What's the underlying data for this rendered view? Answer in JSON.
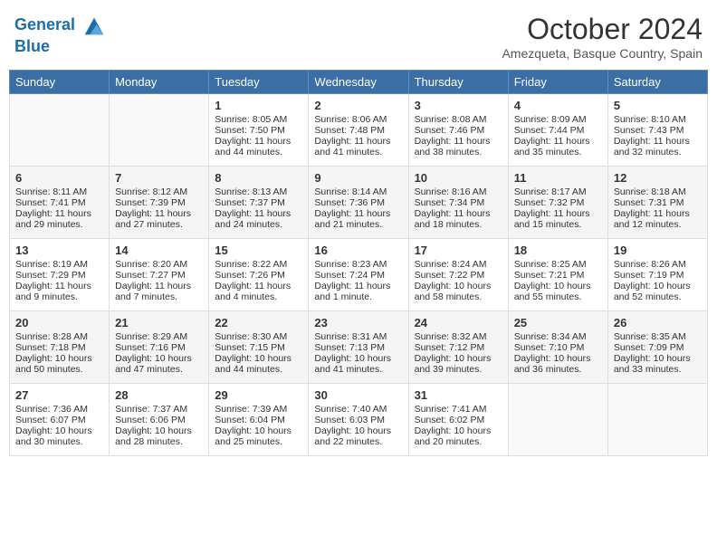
{
  "header": {
    "logo_line1": "General",
    "logo_line2": "Blue",
    "month_year": "October 2024",
    "location": "Amezqueta, Basque Country, Spain"
  },
  "days_of_week": [
    "Sunday",
    "Monday",
    "Tuesday",
    "Wednesday",
    "Thursday",
    "Friday",
    "Saturday"
  ],
  "weeks": [
    [
      {
        "day": "",
        "sunrise": "",
        "sunset": "",
        "daylight": ""
      },
      {
        "day": "",
        "sunrise": "",
        "sunset": "",
        "daylight": ""
      },
      {
        "day": "1",
        "sunrise": "Sunrise: 8:05 AM",
        "sunset": "Sunset: 7:50 PM",
        "daylight": "Daylight: 11 hours and 44 minutes."
      },
      {
        "day": "2",
        "sunrise": "Sunrise: 8:06 AM",
        "sunset": "Sunset: 7:48 PM",
        "daylight": "Daylight: 11 hours and 41 minutes."
      },
      {
        "day": "3",
        "sunrise": "Sunrise: 8:08 AM",
        "sunset": "Sunset: 7:46 PM",
        "daylight": "Daylight: 11 hours and 38 minutes."
      },
      {
        "day": "4",
        "sunrise": "Sunrise: 8:09 AM",
        "sunset": "Sunset: 7:44 PM",
        "daylight": "Daylight: 11 hours and 35 minutes."
      },
      {
        "day": "5",
        "sunrise": "Sunrise: 8:10 AM",
        "sunset": "Sunset: 7:43 PM",
        "daylight": "Daylight: 11 hours and 32 minutes."
      }
    ],
    [
      {
        "day": "6",
        "sunrise": "Sunrise: 8:11 AM",
        "sunset": "Sunset: 7:41 PM",
        "daylight": "Daylight: 11 hours and 29 minutes."
      },
      {
        "day": "7",
        "sunrise": "Sunrise: 8:12 AM",
        "sunset": "Sunset: 7:39 PM",
        "daylight": "Daylight: 11 hours and 27 minutes."
      },
      {
        "day": "8",
        "sunrise": "Sunrise: 8:13 AM",
        "sunset": "Sunset: 7:37 PM",
        "daylight": "Daylight: 11 hours and 24 minutes."
      },
      {
        "day": "9",
        "sunrise": "Sunrise: 8:14 AM",
        "sunset": "Sunset: 7:36 PM",
        "daylight": "Daylight: 11 hours and 21 minutes."
      },
      {
        "day": "10",
        "sunrise": "Sunrise: 8:16 AM",
        "sunset": "Sunset: 7:34 PM",
        "daylight": "Daylight: 11 hours and 18 minutes."
      },
      {
        "day": "11",
        "sunrise": "Sunrise: 8:17 AM",
        "sunset": "Sunset: 7:32 PM",
        "daylight": "Daylight: 11 hours and 15 minutes."
      },
      {
        "day": "12",
        "sunrise": "Sunrise: 8:18 AM",
        "sunset": "Sunset: 7:31 PM",
        "daylight": "Daylight: 11 hours and 12 minutes."
      }
    ],
    [
      {
        "day": "13",
        "sunrise": "Sunrise: 8:19 AM",
        "sunset": "Sunset: 7:29 PM",
        "daylight": "Daylight: 11 hours and 9 minutes."
      },
      {
        "day": "14",
        "sunrise": "Sunrise: 8:20 AM",
        "sunset": "Sunset: 7:27 PM",
        "daylight": "Daylight: 11 hours and 7 minutes."
      },
      {
        "day": "15",
        "sunrise": "Sunrise: 8:22 AM",
        "sunset": "Sunset: 7:26 PM",
        "daylight": "Daylight: 11 hours and 4 minutes."
      },
      {
        "day": "16",
        "sunrise": "Sunrise: 8:23 AM",
        "sunset": "Sunset: 7:24 PM",
        "daylight": "Daylight: 11 hours and 1 minute."
      },
      {
        "day": "17",
        "sunrise": "Sunrise: 8:24 AM",
        "sunset": "Sunset: 7:22 PM",
        "daylight": "Daylight: 10 hours and 58 minutes."
      },
      {
        "day": "18",
        "sunrise": "Sunrise: 8:25 AM",
        "sunset": "Sunset: 7:21 PM",
        "daylight": "Daylight: 10 hours and 55 minutes."
      },
      {
        "day": "19",
        "sunrise": "Sunrise: 8:26 AM",
        "sunset": "Sunset: 7:19 PM",
        "daylight": "Daylight: 10 hours and 52 minutes."
      }
    ],
    [
      {
        "day": "20",
        "sunrise": "Sunrise: 8:28 AM",
        "sunset": "Sunset: 7:18 PM",
        "daylight": "Daylight: 10 hours and 50 minutes."
      },
      {
        "day": "21",
        "sunrise": "Sunrise: 8:29 AM",
        "sunset": "Sunset: 7:16 PM",
        "daylight": "Daylight: 10 hours and 47 minutes."
      },
      {
        "day": "22",
        "sunrise": "Sunrise: 8:30 AM",
        "sunset": "Sunset: 7:15 PM",
        "daylight": "Daylight: 10 hours and 44 minutes."
      },
      {
        "day": "23",
        "sunrise": "Sunrise: 8:31 AM",
        "sunset": "Sunset: 7:13 PM",
        "daylight": "Daylight: 10 hours and 41 minutes."
      },
      {
        "day": "24",
        "sunrise": "Sunrise: 8:32 AM",
        "sunset": "Sunset: 7:12 PM",
        "daylight": "Daylight: 10 hours and 39 minutes."
      },
      {
        "day": "25",
        "sunrise": "Sunrise: 8:34 AM",
        "sunset": "Sunset: 7:10 PM",
        "daylight": "Daylight: 10 hours and 36 minutes."
      },
      {
        "day": "26",
        "sunrise": "Sunrise: 8:35 AM",
        "sunset": "Sunset: 7:09 PM",
        "daylight": "Daylight: 10 hours and 33 minutes."
      }
    ],
    [
      {
        "day": "27",
        "sunrise": "Sunrise: 7:36 AM",
        "sunset": "Sunset: 6:07 PM",
        "daylight": "Daylight: 10 hours and 30 minutes."
      },
      {
        "day": "28",
        "sunrise": "Sunrise: 7:37 AM",
        "sunset": "Sunset: 6:06 PM",
        "daylight": "Daylight: 10 hours and 28 minutes."
      },
      {
        "day": "29",
        "sunrise": "Sunrise: 7:39 AM",
        "sunset": "Sunset: 6:04 PM",
        "daylight": "Daylight: 10 hours and 25 minutes."
      },
      {
        "day": "30",
        "sunrise": "Sunrise: 7:40 AM",
        "sunset": "Sunset: 6:03 PM",
        "daylight": "Daylight: 10 hours and 22 minutes."
      },
      {
        "day": "31",
        "sunrise": "Sunrise: 7:41 AM",
        "sunset": "Sunset: 6:02 PM",
        "daylight": "Daylight: 10 hours and 20 minutes."
      },
      {
        "day": "",
        "sunrise": "",
        "sunset": "",
        "daylight": ""
      },
      {
        "day": "",
        "sunrise": "",
        "sunset": "",
        "daylight": ""
      }
    ]
  ]
}
